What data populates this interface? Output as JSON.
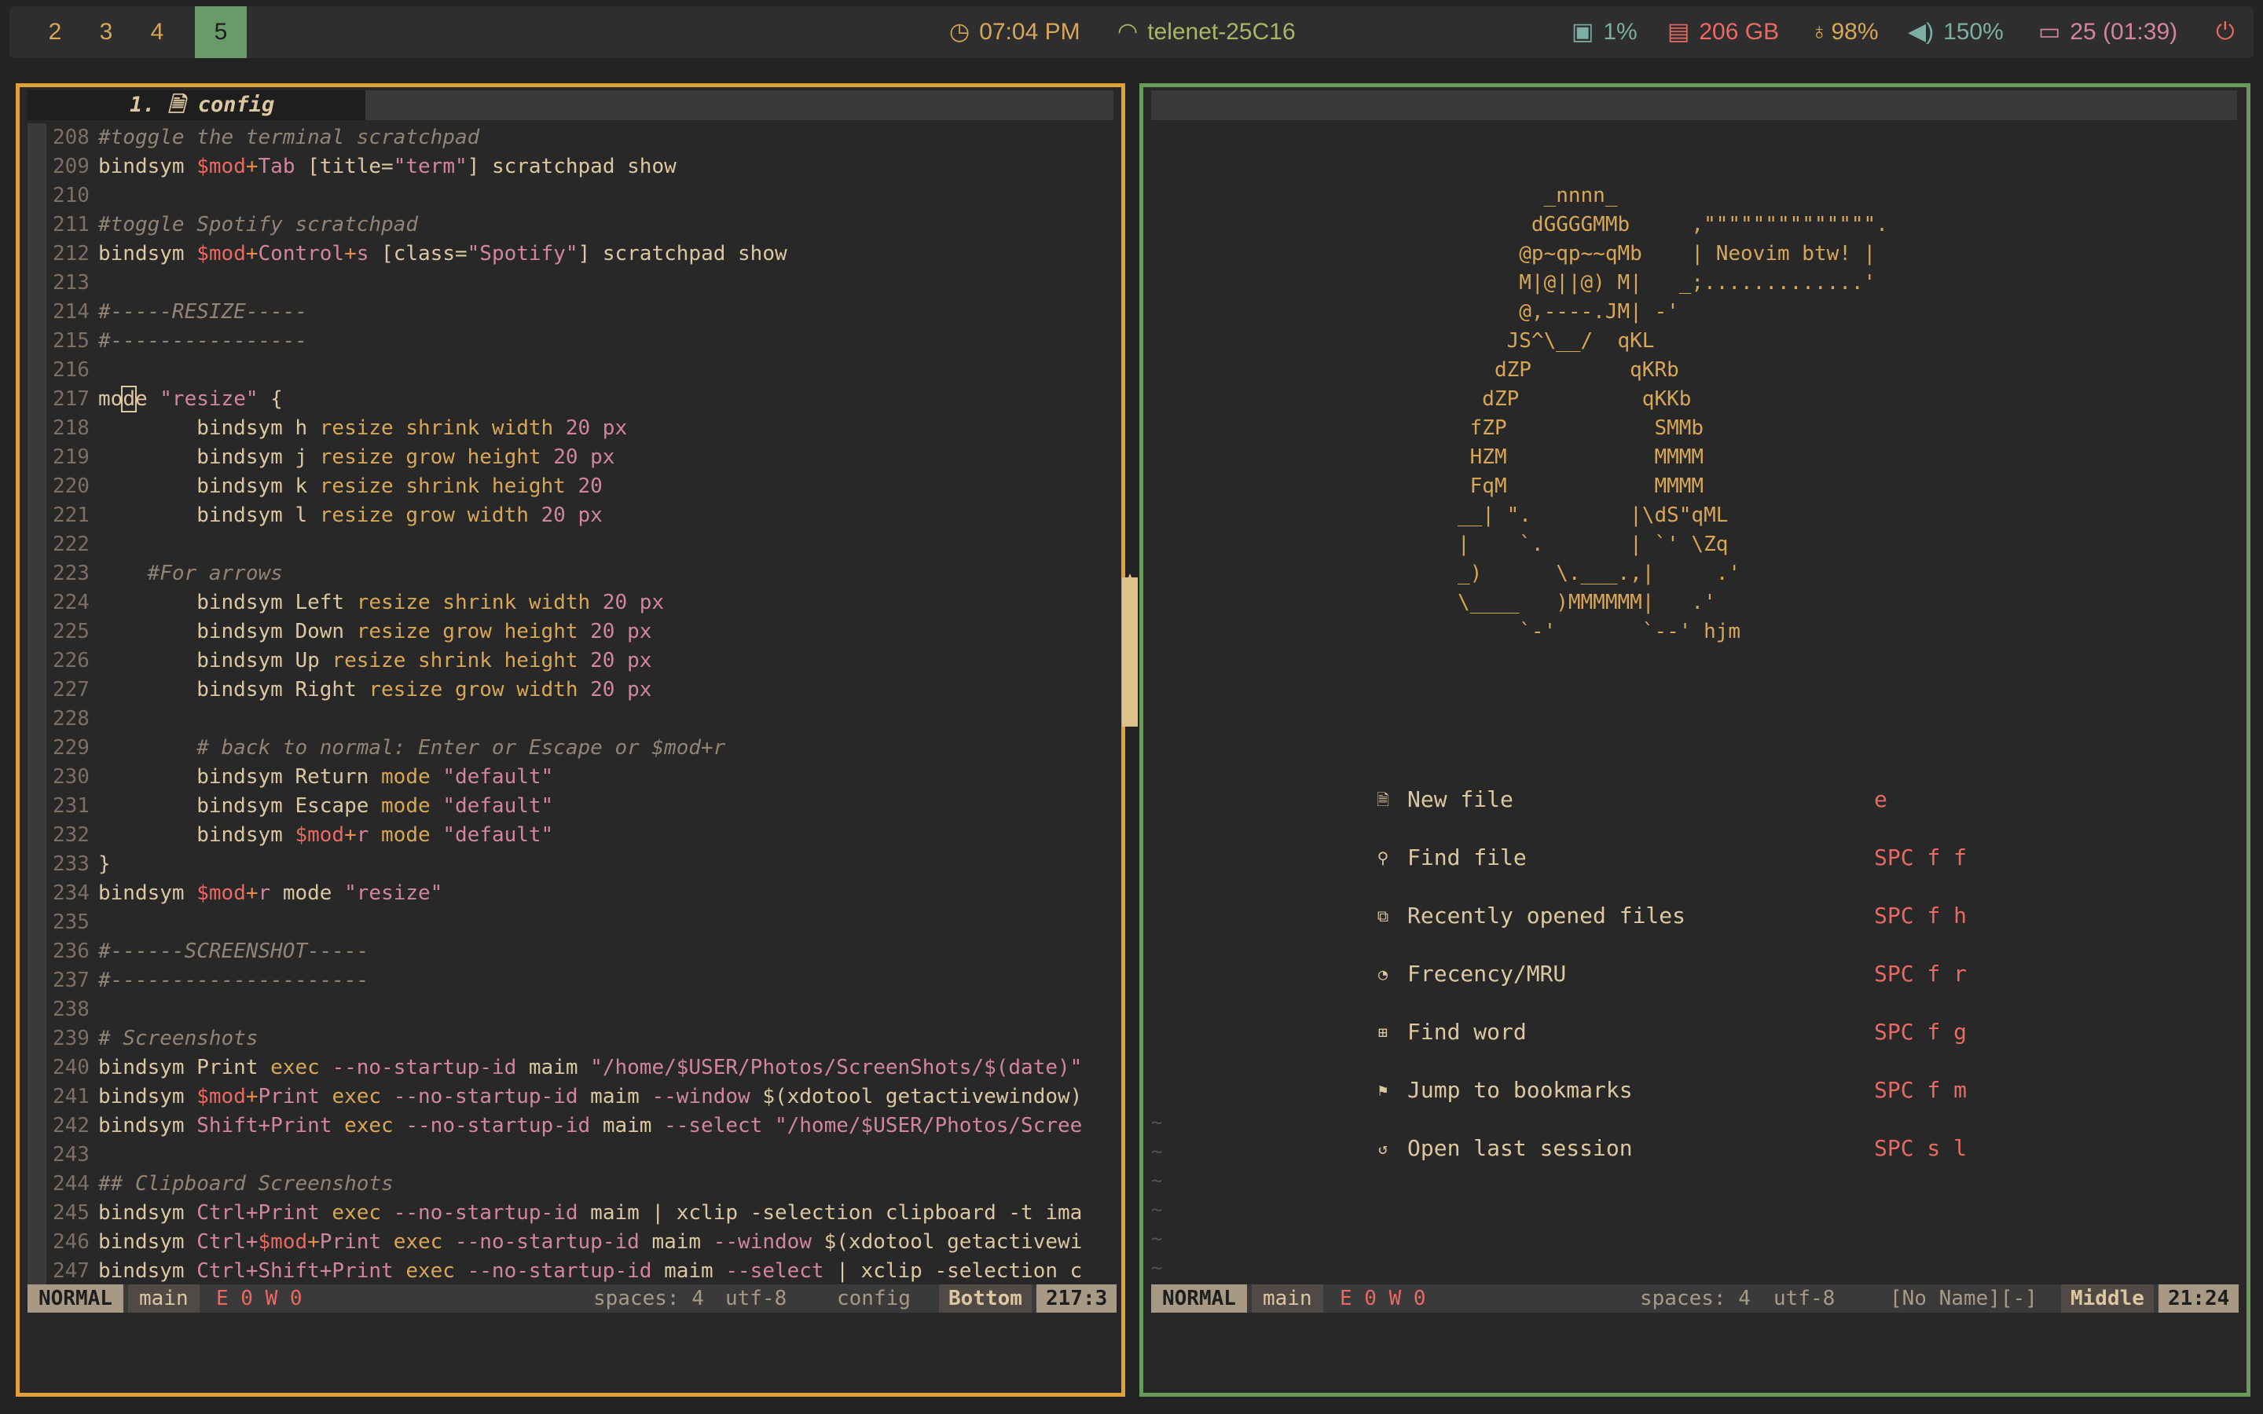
{
  "topbar": {
    "workspaces": [
      {
        "label": "2",
        "active": false
      },
      {
        "label": "3",
        "active": false
      },
      {
        "label": "4",
        "active": false
      },
      {
        "label": "5",
        "active": true
      }
    ],
    "clock": {
      "icon": "clock-icon",
      "text": "07:04 PM",
      "color": "#d8a657"
    },
    "wifi": {
      "icon": "wifi-icon",
      "text": "telenet-25C16",
      "color": "#a9b665"
    },
    "cpu": {
      "icon": "cpu-icon",
      "text": "1%",
      "color": "#7daea3"
    },
    "disk": {
      "icon": "disk-icon",
      "text": "206 GB",
      "color": "#ea6962"
    },
    "brightness": {
      "icon": "bulb-icon",
      "text": "98%",
      "color": "#d8a657"
    },
    "volume": {
      "icon": "volume-icon",
      "text": "150%",
      "color": "#7daea3"
    },
    "battery": {
      "icon": "battery-icon",
      "text": "25 (01:39)",
      "color": "#d3869b"
    },
    "power": {
      "icon": "power-icon",
      "color": "#ea6962"
    }
  },
  "left_editor": {
    "tab_label": "1. 🗎 config",
    "lines": [
      {
        "n": "208",
        "t": [
          [
            "cm",
            "#toggle the terminal scratchpad"
          ]
        ]
      },
      {
        "n": "209",
        "t": [
          [
            "kw",
            "bindsym "
          ],
          [
            "var",
            "$mod"
          ],
          [
            "op",
            "+"
          ],
          [
            "str",
            "Tab"
          ],
          [
            "kw",
            " [title="
          ],
          [
            "str",
            "\"term\""
          ],
          [
            "kw",
            "] scratchpad show"
          ]
        ]
      },
      {
        "n": "210",
        "t": []
      },
      {
        "n": "211",
        "t": [
          [
            "cm",
            "#toggle Spotify scratchpad"
          ]
        ]
      },
      {
        "n": "212",
        "t": [
          [
            "kw",
            "bindsym "
          ],
          [
            "var",
            "$mod"
          ],
          [
            "op",
            "+"
          ],
          [
            "str",
            "Control"
          ],
          [
            "op",
            "+"
          ],
          [
            "str",
            "s"
          ],
          [
            "kw",
            " [class="
          ],
          [
            "str",
            "\"Spotify\""
          ],
          [
            "kw",
            "] scratchpad show"
          ]
        ]
      },
      {
        "n": "213",
        "t": []
      },
      {
        "n": "214",
        "t": [
          [
            "cm",
            "#-----RESIZE-----"
          ]
        ]
      },
      {
        "n": "215",
        "t": [
          [
            "cm",
            "#----------------"
          ]
        ]
      },
      {
        "n": "216",
        "t": []
      },
      {
        "n": "217",
        "t": [
          [
            "kw",
            "mo"
          ],
          [
            "cur",
            "d"
          ],
          [
            "kw",
            "e "
          ],
          [
            "str",
            "\"resize\""
          ],
          [
            "kw",
            " {"
          ]
        ]
      },
      {
        "n": "218",
        "t": [
          [
            "kw",
            "        bindsym h "
          ],
          [
            "fn",
            "resize shrink width "
          ],
          [
            "str",
            "20 px"
          ]
        ]
      },
      {
        "n": "219",
        "t": [
          [
            "kw",
            "        bindsym j "
          ],
          [
            "fn",
            "resize grow height "
          ],
          [
            "str",
            "20 px"
          ]
        ]
      },
      {
        "n": "220",
        "t": [
          [
            "kw",
            "        bindsym k "
          ],
          [
            "fn",
            "resize shrink height "
          ],
          [
            "str",
            "20"
          ]
        ]
      },
      {
        "n": "221",
        "t": [
          [
            "kw",
            "        bindsym l "
          ],
          [
            "fn",
            "resize grow width "
          ],
          [
            "str",
            "20 px"
          ]
        ]
      },
      {
        "n": "222",
        "t": []
      },
      {
        "n": "223",
        "t": [
          [
            "cm",
            "    #For arrows"
          ]
        ]
      },
      {
        "n": "224",
        "t": [
          [
            "kw",
            "        bindsym Left "
          ],
          [
            "fn",
            "resize shrink width "
          ],
          [
            "str",
            "20 px"
          ]
        ]
      },
      {
        "n": "225",
        "t": [
          [
            "kw",
            "        bindsym Down "
          ],
          [
            "fn",
            "resize grow height "
          ],
          [
            "str",
            "20 px"
          ]
        ]
      },
      {
        "n": "226",
        "t": [
          [
            "kw",
            "        bindsym Up "
          ],
          [
            "fn",
            "resize shrink height "
          ],
          [
            "str",
            "20 px"
          ]
        ]
      },
      {
        "n": "227",
        "t": [
          [
            "kw",
            "        bindsym Right "
          ],
          [
            "fn",
            "resize grow width "
          ],
          [
            "str",
            "20 px"
          ]
        ]
      },
      {
        "n": "228",
        "t": []
      },
      {
        "n": "229",
        "t": [
          [
            "cm",
            "        # back to normal: Enter or Escape or $mod+r"
          ]
        ]
      },
      {
        "n": "230",
        "t": [
          [
            "kw",
            "        bindsym Return "
          ],
          [
            "fn",
            "mode "
          ],
          [
            "str",
            "\"default\""
          ]
        ]
      },
      {
        "n": "231",
        "t": [
          [
            "kw",
            "        bindsym Escape "
          ],
          [
            "fn",
            "mode "
          ],
          [
            "str",
            "\"default\""
          ]
        ]
      },
      {
        "n": "232",
        "t": [
          [
            "kw",
            "        bindsym "
          ],
          [
            "var",
            "$mod"
          ],
          [
            "op",
            "+"
          ],
          [
            "str",
            "r "
          ],
          [
            "fn",
            "mode "
          ],
          [
            "str",
            "\"default\""
          ]
        ]
      },
      {
        "n": "233",
        "t": [
          [
            "kw",
            "}"
          ]
        ]
      },
      {
        "n": "234",
        "t": [
          [
            "kw",
            "bindsym "
          ],
          [
            "var",
            "$mod"
          ],
          [
            "op",
            "+"
          ],
          [
            "str",
            "r "
          ],
          [
            "kw",
            "mode "
          ],
          [
            "str",
            "\"resize\""
          ]
        ]
      },
      {
        "n": "235",
        "t": []
      },
      {
        "n": "236",
        "t": [
          [
            "cm",
            "#------SCREENSHOT-----"
          ]
        ]
      },
      {
        "n": "237",
        "t": [
          [
            "cm",
            "#---------------------"
          ]
        ]
      },
      {
        "n": "238",
        "t": []
      },
      {
        "n": "239",
        "t": [
          [
            "cm",
            "# Screenshots"
          ]
        ]
      },
      {
        "n": "240",
        "t": [
          [
            "kw",
            "bindsym Print "
          ],
          [
            "fn",
            "exec "
          ],
          [
            "str",
            "--no-startup-id"
          ],
          [
            "kw",
            " maim "
          ],
          [
            "str",
            "\"/home/$USER/Photos/ScreenShots/$(date)\""
          ]
        ]
      },
      {
        "n": "241",
        "t": [
          [
            "kw",
            "bindsym "
          ],
          [
            "var",
            "$mod"
          ],
          [
            "op",
            "+"
          ],
          [
            "str",
            "Print "
          ],
          [
            "fn",
            "exec "
          ],
          [
            "str",
            "--no-startup-id"
          ],
          [
            "kw",
            " maim "
          ],
          [
            "str",
            "--window"
          ],
          [
            "kw",
            " $(xdotool getactivewindow)"
          ]
        ]
      },
      {
        "n": "242",
        "t": [
          [
            "kw",
            "bindsym "
          ],
          [
            "str",
            "Shift+Print "
          ],
          [
            "fn",
            "exec "
          ],
          [
            "str",
            "--no-startup-id"
          ],
          [
            "kw",
            " maim "
          ],
          [
            "str",
            "--select \"/home/$USER/Photos/Scree"
          ]
        ]
      },
      {
        "n": "243",
        "t": []
      },
      {
        "n": "244",
        "t": [
          [
            "cm",
            "## Clipboard Screenshots"
          ]
        ]
      },
      {
        "n": "245",
        "t": [
          [
            "kw",
            "bindsym "
          ],
          [
            "str",
            "Ctrl+Print "
          ],
          [
            "fn",
            "exec "
          ],
          [
            "str",
            "--no-startup-id"
          ],
          [
            "kw",
            " maim | xclip -selection clipboard -t ima"
          ]
        ]
      },
      {
        "n": "246",
        "t": [
          [
            "kw",
            "bindsym "
          ],
          [
            "str",
            "Ctrl+"
          ],
          [
            "var",
            "$mod"
          ],
          [
            "op",
            "+"
          ],
          [
            "str",
            "Print "
          ],
          [
            "fn",
            "exec "
          ],
          [
            "str",
            "--no-startup-id"
          ],
          [
            "kw",
            " maim "
          ],
          [
            "str",
            "--window"
          ],
          [
            "kw",
            " $(xdotool getactivewi"
          ]
        ]
      },
      {
        "n": "247",
        "t": [
          [
            "kw",
            "bindsym "
          ],
          [
            "str",
            "Ctrl+Shift+Print "
          ],
          [
            "fn",
            "exec "
          ],
          [
            "str",
            "--no-startup-id"
          ],
          [
            "kw",
            " maim "
          ],
          [
            "str",
            "--select"
          ],
          [
            "kw",
            " | xclip -selection c"
          ]
        ]
      }
    ],
    "status": {
      "mode": "NORMAL",
      "branch": "main",
      "diag": "E 0 W 0",
      "indent": "spaces: 4",
      "encoding": "utf-8",
      "filename": "config",
      "scroll": "Bottom",
      "position": "217:3"
    }
  },
  "right_editor": {
    "ascii_art": "       _nnnn_\n      dGGGGMMb     ,\"\"\"\"\"\"\"\"\"\"\"\"\"\".\n     @p~qp~~qMb    | Neovim btw! |\n     M|@||@) M|   _;.............'\n     @,----.JM| -'\n    JS^\\__/  qKL\n   dZP        qKRb\n  dZP          qKKb\n fZP            SMMb\n HZM            MMMM\n FqM            MMMM\n__| \".        |\\dS\"qML\n|    `.       | `' \\Zq\n_)      \\.___.,|     .'\n\\____   )MMMMMM|   .'\n     `-'       `--' hjm",
    "menu": [
      {
        "icon": "file-icon",
        "glyph": "🗎",
        "label": "New file",
        "key": "e"
      },
      {
        "icon": "search-icon",
        "glyph": "⚲",
        "label": "Find file",
        "key": "SPC f f"
      },
      {
        "icon": "files-icon",
        "glyph": "⧉",
        "label": "Recently opened files",
        "key": "SPC f h"
      },
      {
        "icon": "history-icon",
        "glyph": "◔",
        "label": "Frecency/MRU",
        "key": "SPC f r"
      },
      {
        "icon": "find-word-icon",
        "glyph": "⊞",
        "label": "Find word",
        "key": "SPC f g"
      },
      {
        "icon": "bookmark-icon",
        "glyph": "⚑",
        "label": "Jump to bookmarks",
        "key": "SPC f m"
      },
      {
        "icon": "session-icon",
        "glyph": "↺",
        "label": "Open last session",
        "key": "SPC s l"
      }
    ],
    "tildes": [
      "~",
      "~",
      "~",
      "~",
      "~",
      "~"
    ],
    "status": {
      "mode": "NORMAL",
      "branch": "main",
      "diag": "E 0 W 0",
      "indent": "spaces: 4",
      "encoding": "utf-8",
      "filename": "[No Name][-]",
      "scroll": "Middle",
      "position": "21:24"
    }
  },
  "colors": {
    "left_border": "#e0a03a",
    "right_border": "#6a9a5a",
    "workspace_active": "#6a9a6a"
  }
}
